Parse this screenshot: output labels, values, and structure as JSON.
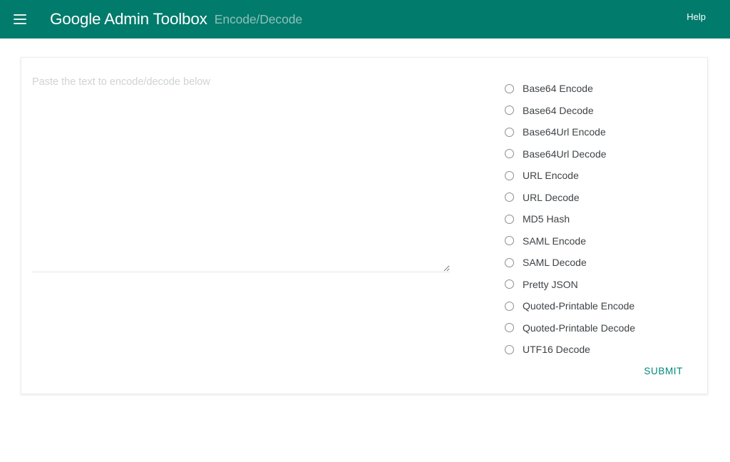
{
  "header": {
    "menu_icon": "hamburger-menu-icon",
    "brand_title": "Google Admin Toolbox",
    "brand_subtitle": "Encode/Decode",
    "help_label": "Help",
    "background_color": "#007b6c",
    "title_color": "#ffffff",
    "subtitle_color": "#8fc0b8"
  },
  "main": {
    "input": {
      "placeholder": "Paste the text to encode/decode below",
      "value": ""
    },
    "modes": [
      {
        "label": "Base64 Encode",
        "selected": false
      },
      {
        "label": "Base64 Decode",
        "selected": false
      },
      {
        "label": "Base64Url Encode",
        "selected": false
      },
      {
        "label": "Base64Url Decode",
        "selected": false
      },
      {
        "label": "URL Encode",
        "selected": false
      },
      {
        "label": "URL Decode",
        "selected": false
      },
      {
        "label": "MD5 Hash",
        "selected": false
      },
      {
        "label": "SAML Encode",
        "selected": false
      },
      {
        "label": "SAML Decode",
        "selected": false
      },
      {
        "label": "Pretty JSON",
        "selected": false
      },
      {
        "label": "Quoted-Printable Encode",
        "selected": false
      },
      {
        "label": "Quoted-Printable Decode",
        "selected": false
      },
      {
        "label": "UTF16 Decode",
        "selected": false
      }
    ],
    "submit_label": "SUBMIT",
    "submit_color": "#00897b"
  }
}
